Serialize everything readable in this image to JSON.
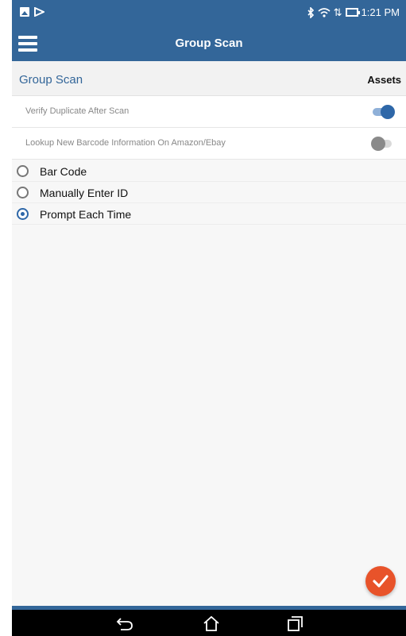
{
  "status_bar": {
    "left_icons": [
      "image-notification-icon",
      "cast-icon"
    ],
    "right_icons": [
      "bluetooth-icon",
      "wifi-icon",
      "battery-icon"
    ],
    "time": "1:21 PM"
  },
  "app_bar": {
    "menu_icon": "hamburger-menu-icon",
    "title": "Group Scan"
  },
  "section": {
    "title": "Group Scan",
    "right_label": "Assets"
  },
  "settings": [
    {
      "label": "Verify Duplicate After Scan",
      "on": true
    },
    {
      "label": "Lookup New Barcode Information On Amazon/Ebay",
      "on": false
    }
  ],
  "scan_mode": {
    "options": [
      "Bar Code",
      "Manually Enter ID",
      "Prompt Each Time"
    ],
    "selected": "Prompt Each Time"
  },
  "fab": {
    "icon": "checkmark-icon",
    "color": "#e8532a"
  },
  "nav_bar": {
    "buttons": [
      "back-icon",
      "home-icon",
      "recent-apps-icon"
    ]
  },
  "colors": {
    "primary": "#336699",
    "accent": "#2e67a8",
    "fab": "#e8532a"
  }
}
